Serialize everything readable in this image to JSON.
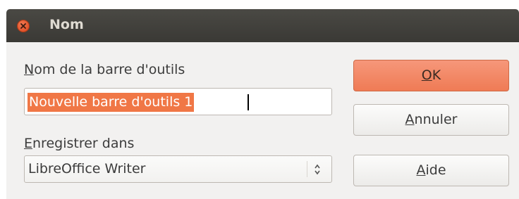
{
  "dialog": {
    "title": "Nom"
  },
  "toolbar_name": {
    "label_mnemonic": "N",
    "label_rest": "om de la barre d'outils",
    "value": "Nouvelle barre d'outils 1"
  },
  "save_in": {
    "label_mnemonic": "E",
    "label_rest": "nregistrer dans",
    "selected": "LibreOffice Writer"
  },
  "buttons": {
    "ok": {
      "mnemonic": "O",
      "rest": "K"
    },
    "cancel": {
      "mnemonic": "A",
      "rest": "nnuler"
    },
    "help": {
      "mnemonic": "A",
      "rest": "ide"
    }
  },
  "colors": {
    "titlebar": "#3f3e3a",
    "accent": "#ef7b55",
    "selection": "#f07746",
    "dialog_bg": "#f2f1f0"
  },
  "icons": {
    "close": "close-icon",
    "spinner": "spinner-arrows-icon"
  }
}
